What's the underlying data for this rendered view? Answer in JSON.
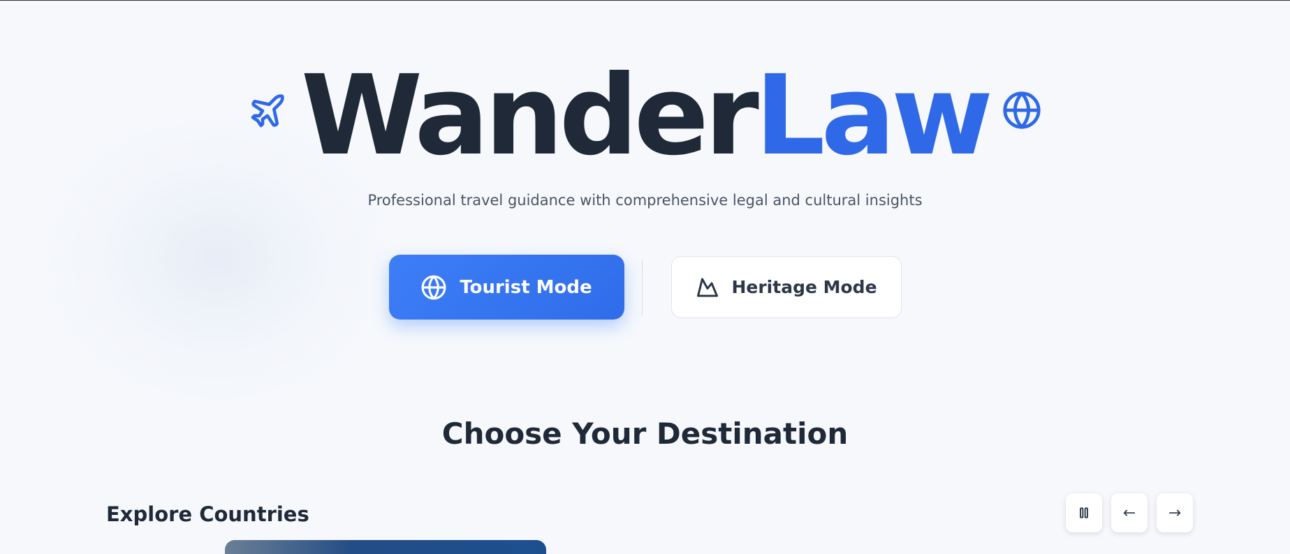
{
  "brand": {
    "title_dark": "Wander",
    "title_blue": "Law",
    "left_icon": "airplane-icon",
    "right_icon": "globe-icon"
  },
  "subtitle": "Professional travel guidance with comprehensive legal and cultural insights",
  "modes": {
    "tourist": {
      "label": "Tourist Mode",
      "icon": "globe-icon",
      "active": true
    },
    "heritage": {
      "label": "Heritage Mode",
      "icon": "mountain-icon",
      "active": false
    }
  },
  "section_title": "Choose Your Destination",
  "explore": {
    "label": "Explore Countries",
    "controls": {
      "pause_icon": "pause-icon",
      "prev_label": "←",
      "next_label": "→"
    }
  },
  "colors": {
    "accent": "#2f69e8",
    "text_dark": "#1f2937",
    "text_muted": "#4b5563",
    "background": "#f6f8fc"
  }
}
